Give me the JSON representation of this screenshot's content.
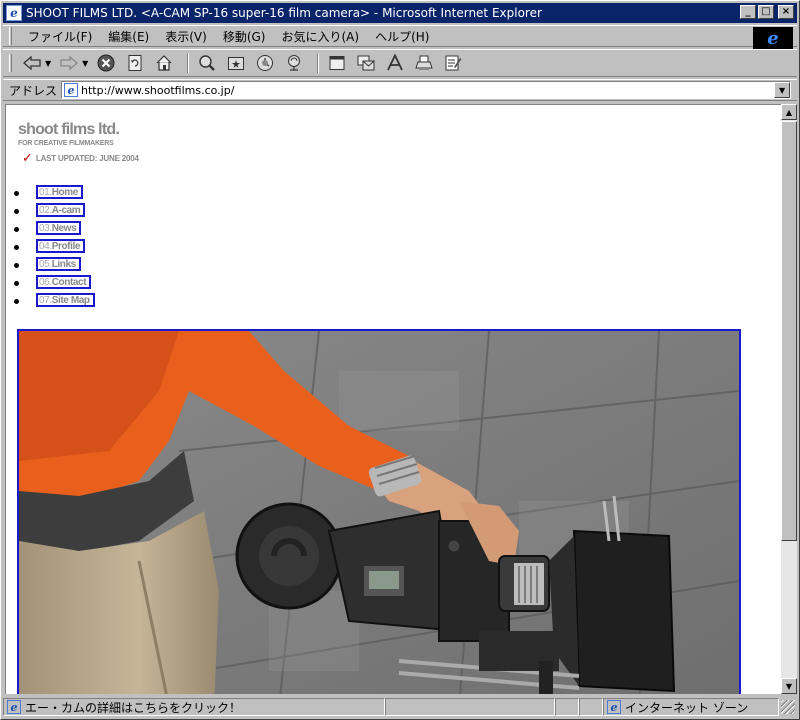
{
  "window": {
    "title": "SHOOT FILMS LTD. <A-CAM SP-16 super-16 film camera> - Microsoft Internet Explorer",
    "buttons": {
      "minimize": "_",
      "maximize": "□",
      "close": "×"
    }
  },
  "menu": {
    "items": [
      {
        "label": "ファイル(F)"
      },
      {
        "label": "編集(E)"
      },
      {
        "label": "表示(V)"
      },
      {
        "label": "移動(G)"
      },
      {
        "label": "お気に入り(A)"
      },
      {
        "label": "ヘルプ(H)"
      }
    ],
    "logo": "e"
  },
  "toolbar": {
    "icons": [
      "back-icon",
      "forward-icon",
      "stop-icon",
      "refresh-icon",
      "home-icon",
      "search-icon",
      "favorites-icon",
      "history-icon",
      "channels-icon",
      "fullscreen-icon",
      "mail-icon",
      "font-icon",
      "print-icon",
      "edit-icon"
    ]
  },
  "address": {
    "label": "アドレス",
    "url": "http://www.shootfilms.co.jp/"
  },
  "page": {
    "brand": "shoot films ltd.",
    "tagline": "FOR CREATIVE FILMMAKERS",
    "updated": "LAST UPDATED: JUNE 2004",
    "nav": [
      {
        "num": "01.",
        "label": "Home"
      },
      {
        "num": "02.",
        "label": "A-cam"
      },
      {
        "num": "03.",
        "label": "News"
      },
      {
        "num": "04.",
        "label": "Profile"
      },
      {
        "num": "05.",
        "label": "Links"
      },
      {
        "num": "06.",
        "label": "Contact"
      },
      {
        "num": "07.",
        "label": "Site Map"
      }
    ]
  },
  "status": {
    "message": "エー・カムの詳細はこちらをクリック！",
    "zone": "インターネット ゾーン"
  },
  "colors": {
    "titlebar": "#0a246a",
    "chrome": "#c0c0c0",
    "link_border": "#1a1acc",
    "check": "#c00000",
    "sweater": "#e8601c"
  }
}
